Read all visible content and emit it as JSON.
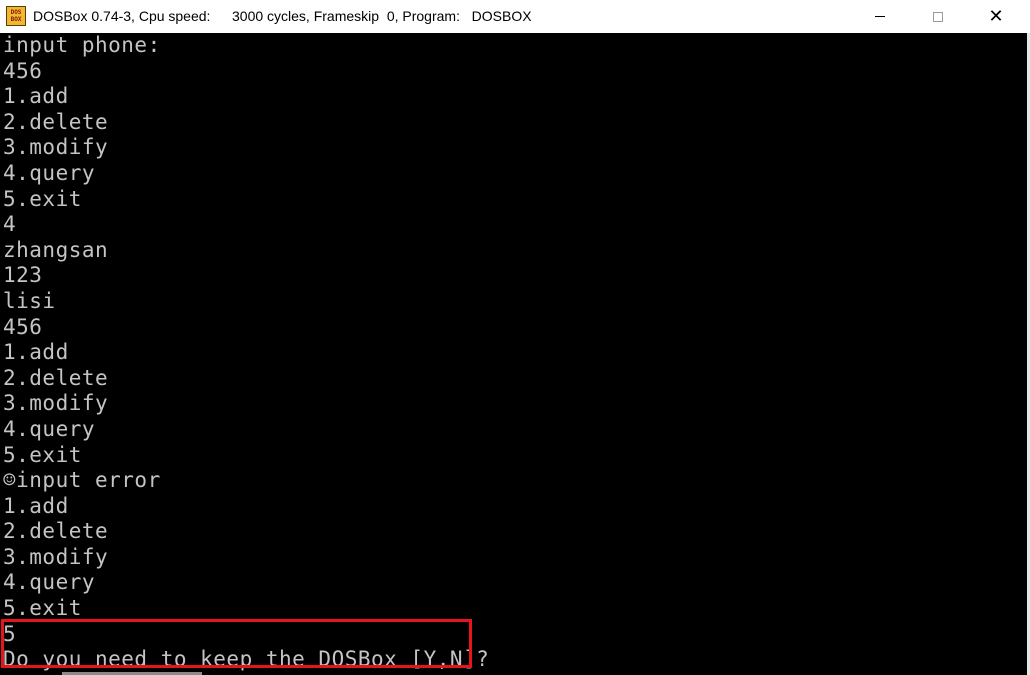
{
  "window": {
    "title": "DOSBox 0.74-3, Cpu speed:",
    "stats": "3000 cycles, Frameskip  0, Program:   DOSBOX",
    "icon_label_top": "DOS",
    "icon_label_bottom": "BOX",
    "icon": "dosbox-icon",
    "controls": {
      "minimize_icon": "minimize-icon",
      "maximize_icon": "maximize-icon",
      "close_icon": "close-icon",
      "close_glyph": "✕"
    }
  },
  "console": {
    "text_color": "#c4c4c4",
    "background": "#000000",
    "highlight_color": "#e8141c",
    "lines": [
      "input phone:",
      "456",
      "1.add",
      "2.delete",
      "3.modify",
      "4.query",
      "5.exit",
      "4",
      "zhangsan",
      "123",
      "lisi",
      "456",
      "1.add",
      "2.delete",
      "3.modify",
      "4.query",
      "5.exit",
      "☺input error",
      "1.add",
      "2.delete",
      "3.modify",
      "4.query",
      "5.exit",
      "5",
      "Do you need to keep the DOSBox [Y,N]?"
    ]
  }
}
